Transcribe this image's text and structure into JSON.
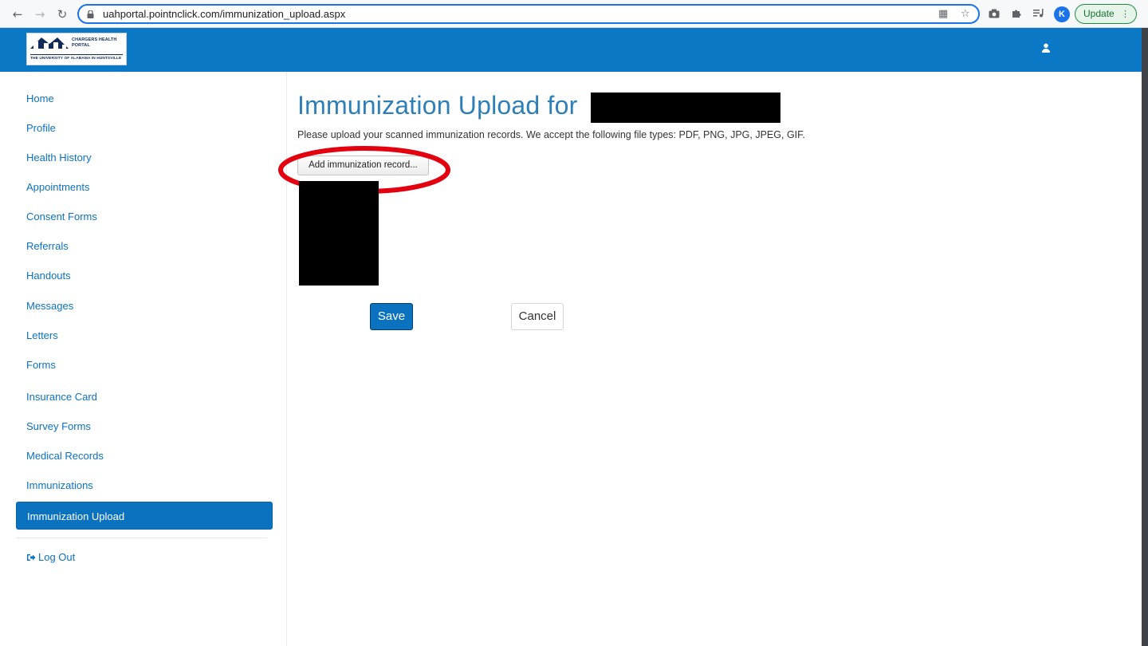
{
  "browser": {
    "url": "uahportal.pointnclick.com/immunization_upload.aspx",
    "back_icon": "←",
    "forward_icon": "→",
    "reload_icon": "↻",
    "profile_initial": "K",
    "update_label": "Update"
  },
  "header": {
    "logo_line1": "CHARGERS HEALTH",
    "logo_line2": "PORTAL",
    "logo_line3": "THE UNIVERSITY OF ALABAMA IN HUNTSVILLE",
    "logo_brand_color": "#102a5c",
    "background_color": "#0b78c5"
  },
  "sidebar": {
    "items": [
      {
        "label": "Home"
      },
      {
        "label": "Profile"
      },
      {
        "label": "Health History"
      },
      {
        "label": "Appointments"
      },
      {
        "label": "Consent Forms"
      },
      {
        "label": "Referrals"
      },
      {
        "label": "Handouts"
      },
      {
        "label": "Messages"
      },
      {
        "label": "Letters"
      },
      {
        "label": "Forms"
      },
      {
        "label": "Insurance Card"
      },
      {
        "label": "Survey Forms"
      },
      {
        "label": "Medical Records"
      },
      {
        "label": "Immunizations"
      },
      {
        "label": "Immunization Upload",
        "active": true
      }
    ],
    "logout_label": "Log Out"
  },
  "main": {
    "title": "Immunization Upload for",
    "instructions": "Please upload your scanned immunization records. We accept the following file types: PDF, PNG, JPG, JPEG, GIF.",
    "add_record_label": "Add immunization record...",
    "save_label": "Save",
    "cancel_label": "Cancel",
    "accent_color": "#0b72c0",
    "highlight_color": "#e3000f"
  }
}
